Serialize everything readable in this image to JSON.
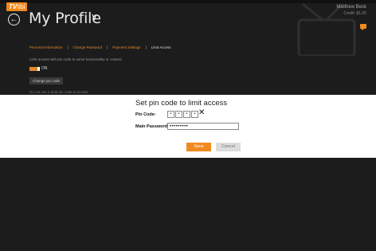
{
  "app": {
    "logo_text": "TV",
    "logo_tail": "tibi"
  },
  "header": {
    "title": "My Profile",
    "chevron": "∨",
    "back_glyph": "←",
    "user_name": "Matthew Beck",
    "user_credit": "Credit: $1.00"
  },
  "tabs": [
    {
      "label": "Personal Information"
    },
    {
      "label": "Change Password"
    },
    {
      "label": "Payment Settings"
    },
    {
      "label": "Limit Access"
    }
  ],
  "limit_access": {
    "description": "Limit access with pin code to some functionality or content",
    "toggle_state": "ON",
    "change_pin_label": "Change pin code",
    "peek_text": "Do not use a dual pin code to access"
  },
  "dialog": {
    "title": "Set pin code to limit access",
    "pin_label": "Pin Code:",
    "pin_digits": [
      "•",
      "•",
      "•",
      "•"
    ],
    "clear_glyph": "✕",
    "password_label": "Main Password:",
    "password_value": "•••••••••",
    "save_label": "Save",
    "cancel_label": "Cancel"
  },
  "colors": {
    "accent": "#f08a1f",
    "background": "#1c1c1c",
    "dialog": "#ffffff"
  },
  "icons": [
    "back-arrow-icon",
    "chevron-down-icon",
    "chat-icon",
    "tv-decoration-icon",
    "clear-icon"
  ]
}
